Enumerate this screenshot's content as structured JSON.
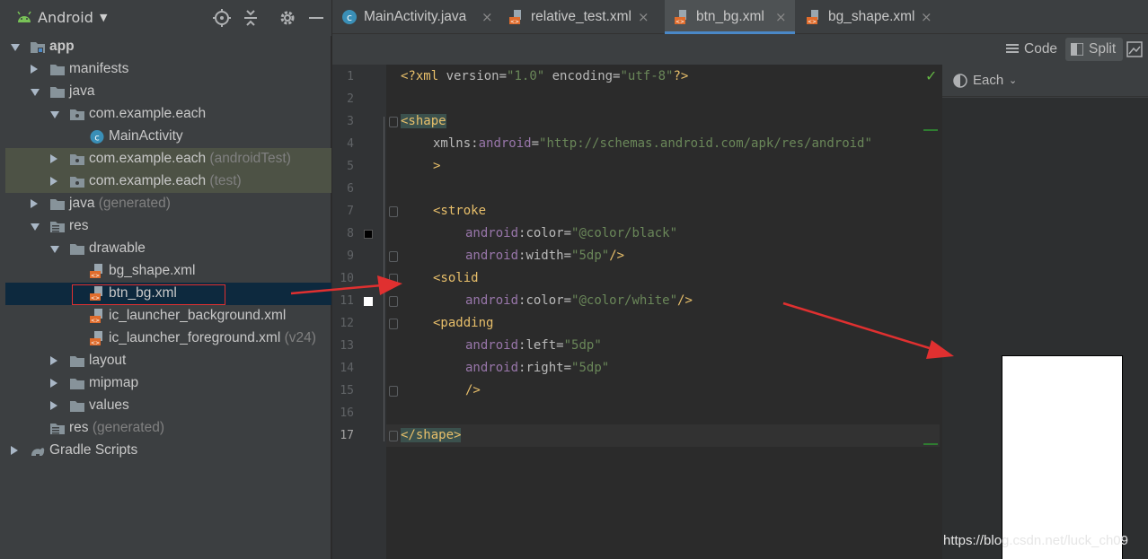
{
  "panel": {
    "view_label": "Android",
    "icons": [
      "android-icon",
      "locate-icon",
      "collapse-all-icon",
      "settings-icon",
      "hide-icon"
    ]
  },
  "tree": [
    {
      "name": "app",
      "suffix": "",
      "icon": "module-icon"
    },
    {
      "name": "manifests",
      "suffix": "",
      "icon": "folder-icon"
    },
    {
      "name": "java",
      "suffix": "",
      "icon": "folder-icon"
    },
    {
      "name": "com.example.each",
      "suffix": "",
      "icon": "package-icon"
    },
    {
      "name": "MainActivity",
      "suffix": "",
      "icon": "class-icon"
    },
    {
      "name": "com.example.each",
      "suffix": "(androidTest)",
      "icon": "package-icon"
    },
    {
      "name": "com.example.each",
      "suffix": "(test)",
      "icon": "package-icon"
    },
    {
      "name": "java",
      "suffix": "(generated)",
      "icon": "folder-icon"
    },
    {
      "name": "res",
      "suffix": "",
      "icon": "res-folder-icon"
    },
    {
      "name": "drawable",
      "suffix": "",
      "icon": "folder-icon"
    },
    {
      "name": "bg_shape.xml",
      "suffix": "",
      "icon": "xml-file-icon"
    },
    {
      "name": "btn_bg.xml",
      "suffix": "",
      "icon": "xml-file-icon"
    },
    {
      "name": "ic_launcher_background.xml",
      "suffix": "",
      "icon": "xml-file-icon"
    },
    {
      "name": "ic_launcher_foreground.xml",
      "suffix": "(v24)",
      "icon": "xml-file-icon"
    },
    {
      "name": "layout",
      "suffix": "",
      "icon": "folder-icon"
    },
    {
      "name": "mipmap",
      "suffix": "",
      "icon": "folder-icon"
    },
    {
      "name": "values",
      "suffix": "",
      "icon": "folder-icon"
    },
    {
      "name": "res",
      "suffix": "(generated)",
      "icon": "res-folder-icon"
    },
    {
      "name": "Gradle Scripts",
      "suffix": "",
      "icon": "gradle-icon"
    }
  ],
  "tabs": [
    {
      "label": "MainActivity.java",
      "close": "×",
      "icon": "class-icon"
    },
    {
      "label": "relative_test.xml",
      "close": "×",
      "icon": "xml-file-icon"
    },
    {
      "label": "btn_bg.xml",
      "close": "×",
      "icon": "xml-file-icon"
    },
    {
      "label": "bg_shape.xml",
      "close": "×",
      "icon": "xml-file-icon"
    }
  ],
  "view_modes": {
    "code": "Code",
    "split": "Split"
  },
  "editor": {
    "line_numbers": [
      "1",
      "2",
      "3",
      "4",
      "5",
      "6",
      "7",
      "8",
      "9",
      "10",
      "11",
      "12",
      "13",
      "14",
      "15",
      "16",
      "17"
    ],
    "lines": {
      "l1_open": "<?xml ",
      "l1_attr1": "version",
      "l1_eq1": "=",
      "l1_val1": "\"1.0\"",
      "l1_attr2": " encoding",
      "l1_eq2": "=",
      "l1_val2": "\"utf-8\"",
      "l1_close": "?>",
      "l3_tag": "<shape",
      "l4_ns": "xmlns",
      "l4_colon": ":",
      "l4_attr": "android",
      "l4_eq": "=",
      "l4_val": "\"http://schemas.android.com/apk/res/android\"",
      "l5": ">",
      "l7_tag": "<stroke",
      "l8_ns": "android",
      "l8_attr": ":color",
      "l8_eq": "=",
      "l8_val": "\"@color/black\"",
      "l9_ns": "android",
      "l9_attr": ":width",
      "l9_eq": "=",
      "l9_val": "\"5dp\"",
      "l9_close": "/>",
      "l10_tag": "<solid",
      "l11_ns": "android",
      "l11_attr": ":color",
      "l11_eq": "=",
      "l11_val": "\"@color/white\"",
      "l11_close": "/>",
      "l12_tag": "<padding",
      "l13_ns": "android",
      "l13_attr": ":left",
      "l13_eq": "=",
      "l13_val": "\"5dp\"",
      "l14_ns": "android",
      "l14_attr": ":right",
      "l14_eq": "=",
      "l14_val": "\"5dp\"",
      "l15": "/>",
      "l17_tag": "</shape>"
    },
    "swatch_colors": {
      "black": "#000000",
      "white": "#ffffff"
    }
  },
  "preview": {
    "device_label": "Each"
  },
  "watermark": "https://blog.csdn.net/luck_ch09",
  "colors": {
    "accent": "#4a88c7",
    "annotation": "#e03030",
    "check": "#62b543"
  }
}
